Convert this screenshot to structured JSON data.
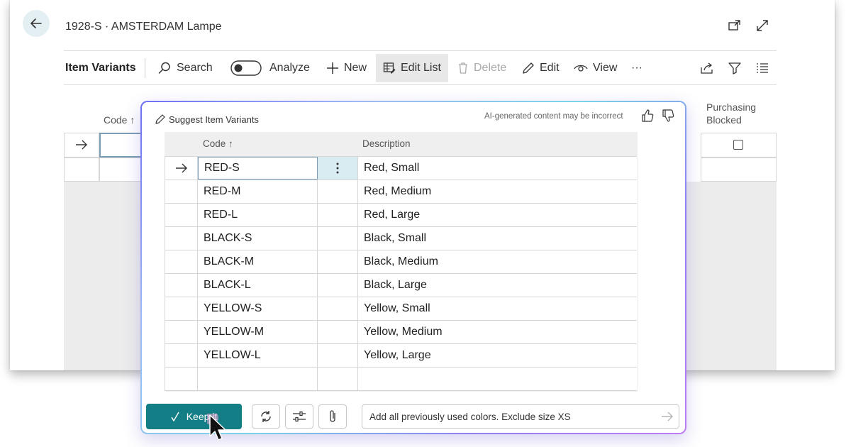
{
  "page": {
    "title": "1928-S · AMSTERDAM Lampe",
    "heading": "Item Variants"
  },
  "toolbar": {
    "search": "Search",
    "analyze": "Analyze",
    "new": "New",
    "edit_list": "Edit List",
    "delete": "Delete",
    "edit": "Edit",
    "view": "View",
    "more": "···"
  },
  "background_list": {
    "code_header": "Code ↑",
    "purchasing_blocked_header_line1": "Purchasing",
    "purchasing_blocked_header_line2": "Blocked"
  },
  "dialog": {
    "title": "Suggest Item Variants",
    "disclaimer": "AI-generated content may be incorrect",
    "columns": {
      "code": "Code ↑",
      "description": "Description"
    },
    "rows": [
      {
        "code": "RED-S",
        "description": "Red, Small"
      },
      {
        "code": "RED-M",
        "description": "Red, Medium"
      },
      {
        "code": "RED-L",
        "description": "Red, Large"
      },
      {
        "code": "BLACK-S",
        "description": "Black, Small"
      },
      {
        "code": "BLACK-M",
        "description": "Black, Medium"
      },
      {
        "code": "BLACK-L",
        "description": "Black, Large"
      },
      {
        "code": "YELLOW-S",
        "description": "Yellow, Small"
      },
      {
        "code": "YELLOW-M",
        "description": "Yellow, Medium"
      },
      {
        "code": "YELLOW-L",
        "description": "Yellow, Large"
      },
      {
        "code": "",
        "description": ""
      }
    ],
    "keep_label": "Keep it",
    "prompt_text": "Add all previously used colors. Exclude size XS"
  },
  "colors": {
    "accent": "#137e85",
    "selected_cell": "#d9ecf2",
    "dialog_border_gradient": [
      "#6f6ef3",
      "#79d4e9",
      "#c07df3"
    ]
  },
  "icons": [
    "back-arrow-icon",
    "popout-icon",
    "expand-icon",
    "search-icon",
    "toggle-icon",
    "plus-icon",
    "edit-list-icon",
    "trash-icon",
    "pencil-icon",
    "eye-icon",
    "share-icon",
    "filter-icon",
    "list-icon",
    "pencil-sparkle-icon",
    "thumbs-up-icon",
    "thumbs-down-icon",
    "row-arrow-icon",
    "kebab-icon",
    "check-icon",
    "regenerate-icon",
    "settings-sliders-icon",
    "attach-icon",
    "send-arrow-icon",
    "mouse-cursor-icon"
  ]
}
